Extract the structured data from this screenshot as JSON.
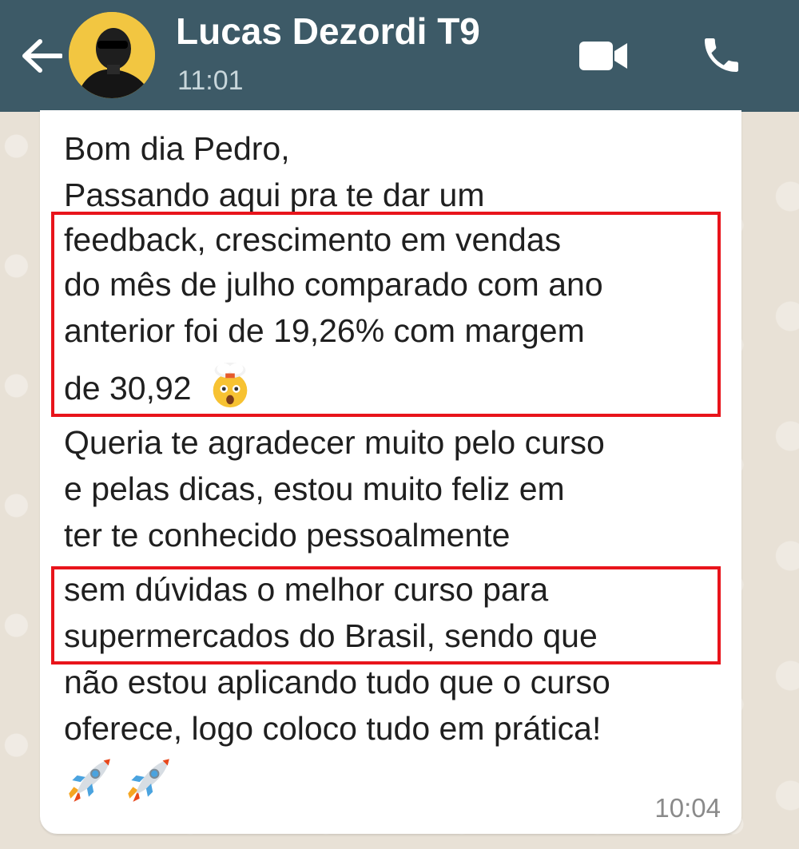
{
  "header": {
    "contact_name": "Lucas Dezordi T9",
    "status_time": "11:01",
    "bg_color": "#3d5a67"
  },
  "icons": {
    "back": "arrow-left-icon",
    "video": "video-camera-icon",
    "call": "phone-icon"
  },
  "message": {
    "lines": [
      "Bom dia Pedro,",
      "Passando aqui pra te dar um",
      "feedback, crescimento em vendas",
      "do mês de julho comparado com ano",
      "anterior foi de 19,26% com margem",
      "de 30,92",
      "Queria te agradecer muito pelo curso",
      "e pelas dicas, estou muito feliz em",
      "ter te conhecido pessoalmente",
      "sem dúvidas o melhor curso para",
      "supermercados do Brasil, sendo que",
      "não estou aplicando tudo que o curso",
      "oferece, logo coloco tudo em prática!"
    ],
    "time": "10:04",
    "highlight_color": "#e8141b"
  }
}
